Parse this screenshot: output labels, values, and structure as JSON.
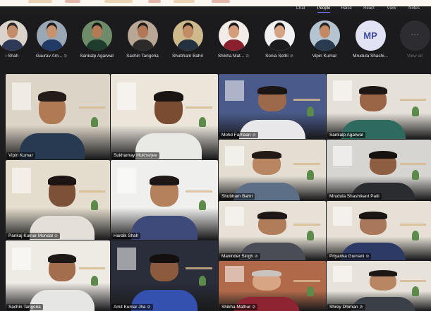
{
  "window": {
    "menu": [
      {
        "label": "Chat",
        "active": false
      },
      {
        "label": "People",
        "active": true
      },
      {
        "label": "Raise",
        "active": false
      },
      {
        "label": "React",
        "active": false
      },
      {
        "label": "View",
        "active": false
      },
      {
        "label": "Notes",
        "active": false
      }
    ]
  },
  "strip": {
    "people": [
      {
        "name": "i Shah",
        "muted": false,
        "shirt": "#2f3a56",
        "skin": "#c48d6a",
        "hair": "#2a2220",
        "bg": "#d9d3cb"
      },
      {
        "name": "Gaurav Am...",
        "muted": true,
        "shirt": "#223a66",
        "skin": "#c7936f",
        "hair": "#1e1a18",
        "bg": "#9aa7b5"
      },
      {
        "name": "Sankalp Agarwal",
        "muted": false,
        "shirt": "#1f3d2c",
        "skin": "#b47a56",
        "hair": "#1b1614",
        "bg": "#6f8c6a"
      },
      {
        "name": "Sachin Tangoria",
        "muted": false,
        "shirt": "#2d2a2a",
        "skin": "#b07856",
        "hair": "#1d1715",
        "bg": "#b8a794"
      },
      {
        "name": "Shubham Bahri",
        "muted": false,
        "shirt": "#24313f",
        "skin": "#c18c66",
        "hair": "#221a16",
        "bg": "#cdb98c"
      },
      {
        "name": "Shikha Mat...",
        "muted": true,
        "shirt": "#8a1f2d",
        "skin": "#d49e7c",
        "hair": "#1d1614",
        "bg": "#f2ece8"
      },
      {
        "name": "Sonia Sethi",
        "muted": true,
        "shirt": "#1c1c1e",
        "skin": "#d7a483",
        "hair": "#1a1412",
        "bg": "#f1f1f1"
      },
      {
        "name": "Vipin Kumar",
        "muted": false,
        "shirt": "#2a3a4f",
        "skin": "#c18a64",
        "hair": "#2a2220",
        "bg": "#b5c4d1"
      },
      {
        "name": "Mrudula Shashi...",
        "muted": false,
        "initials": "MP"
      },
      {
        "name": "View all",
        "muted": false,
        "more": "···"
      }
    ]
  },
  "grid": {
    "tiles": [
      {
        "name": "Vipin Kumar",
        "muted": false,
        "bg": "#dcd4c6",
        "shirt": "#273a52",
        "skin": "#b07a55",
        "hair": "#241c18"
      },
      {
        "name": "Sukhamay Mukherjee",
        "muted": false,
        "bg": "#ebe5da",
        "shirt": "#e9e9e6",
        "skin": "#7a4d33",
        "hair": "#1a1412"
      },
      {
        "name": "Mohd Farhaan",
        "muted": true,
        "bg": "#4a5a8a",
        "shirt": "#e8e8ea",
        "skin": "#9c6a4b",
        "hair": "#1b1513"
      },
      {
        "name": "Sankalp Agarwal",
        "muted": false,
        "bg": "#e6e1d8",
        "shirt": "#2f6a5e",
        "skin": "#9a6447",
        "hair": "#1d1614"
      },
      {
        "name": "Pankaj Kumar Mondal",
        "muted": true,
        "bg": "#e4dccd",
        "shirt": "#e4e0d9",
        "skin": "#7c5137",
        "hair": "#1c1513"
      },
      {
        "name": "Hardik Shah",
        "muted": false,
        "bg": "#efefee",
        "shirt": "#3e4a7a",
        "skin": "#b5805c",
        "hair": "#1e1715"
      },
      {
        "name": "Shubham Bahri",
        "muted": false,
        "bg": "#e3ddd2",
        "shirt": "#5d6f86",
        "skin": "#b98663",
        "hair": "#211a16"
      },
      {
        "name": "Mrudula Shashikant Patil",
        "muted": false,
        "bg": "#d7d5d1",
        "shirt": "#2a2c30",
        "skin": "#8e5e43",
        "hair": "#161210"
      },
      {
        "name": "Maninder Singh",
        "muted": true,
        "bg": "#e7e1d7",
        "shirt": "#4a4d55",
        "skin": "#b07c5a",
        "hair": "#1d1715"
      },
      {
        "name": "Priyanka Gurnani",
        "muted": true,
        "bg": "#e6e0d6",
        "shirt": "#2e3a66",
        "skin": "#a9785b",
        "hair": "#1a1412"
      },
      {
        "name": "Sachin Tangoria",
        "muted": false,
        "bg": "#eeeae4",
        "shirt": "#e6e6e4",
        "skin": "#a36e4e",
        "hair": "#1d1715"
      },
      {
        "name": "Amit Kumar Jha",
        "muted": true,
        "bg": "#2a2e3a",
        "shirt": "#3451b0",
        "skin": "#8c5b3e",
        "hair": "#141010"
      },
      {
        "name": "Shikha Mathur",
        "muted": true,
        "bg": "#b06a4a",
        "shirt": "#8e2432",
        "skin": "#d7a584",
        "hair": "#c9c4bf"
      },
      {
        "name": "Shrey Dhiman",
        "muted": true,
        "bg": "#e8e3da",
        "shirt": "#3b3f47",
        "skin": "#b88663",
        "hair": "#1d1715"
      }
    ]
  },
  "icons": {
    "mic_off": "🎙"
  }
}
